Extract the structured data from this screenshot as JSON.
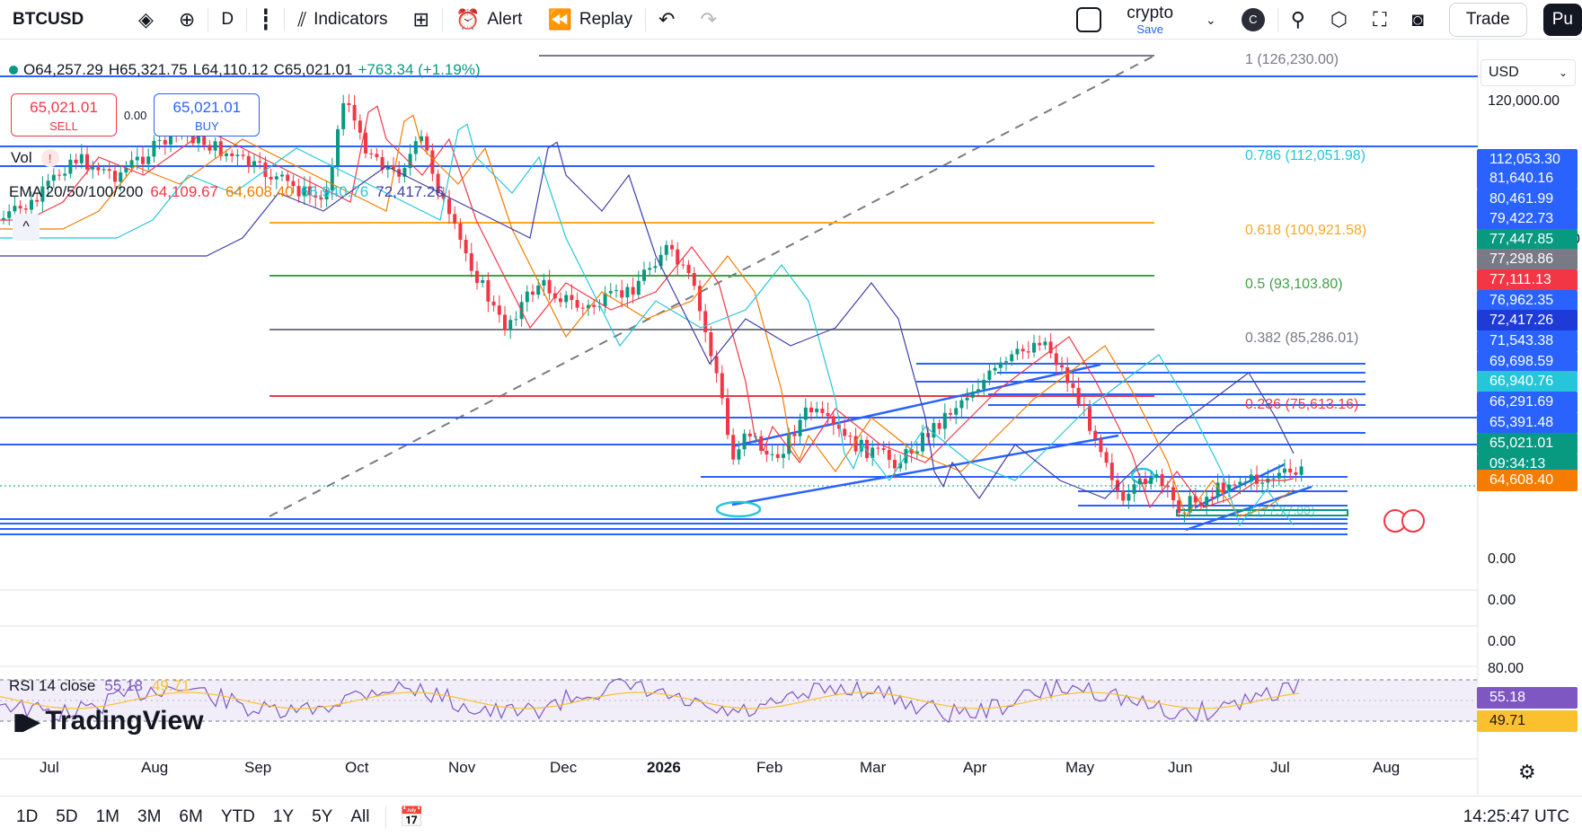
{
  "toolbar": {
    "symbol": "BTCUSD",
    "interval": "D",
    "indicators_label": "Indicators",
    "alert_label": "Alert",
    "replay_label": "Replay",
    "layout_name": "crypto",
    "layout_save": "Save",
    "avatar_letter": "C",
    "trade_label": "Trade",
    "publish_label": "Pu"
  },
  "legend": {
    "open": "O64,257.29",
    "high": "H65,321.75",
    "low": "L64,110.12",
    "close": "C65,021.01",
    "change": "+763.34 (+1.19%)",
    "sell_price": "65,021.01",
    "sell_label": "SELL",
    "buy_price": "65,021.01",
    "buy_label": "BUY",
    "spread": "0.00",
    "vol_label": "Vol",
    "ema_label": "EMA 20/50/100/200",
    "ema20": "64,109.67",
    "ema50": "64,608.40",
    "ema100": "66,940.76",
    "ema200": "72,417.26",
    "rsi_label": "RSI 14 close",
    "rsi_value": "55.18",
    "rsi_ma": "49.71",
    "logo_text": "TradingView",
    "collapse_glyph": "^"
  },
  "fib_labels": {
    "f1": "1 (126,230.00)",
    "f786": "0.786 (112,051.98)",
    "f618": "0.618 (100,921.58)",
    "f5": "0.5 (93,103.80)",
    "f382": "0.382 (85,286.01)",
    "f236": "0.236 (75,613.16)",
    "f0": "0 (77,77.80)"
  },
  "price_scale": {
    "currency": "USD",
    "tick_120k": "120,000.00",
    "edge_digit": "0",
    "labels": [
      {
        "text": "112,053.30",
        "color": "#2962ff"
      },
      {
        "text": "81,640.16",
        "color": "#2962ff"
      },
      {
        "text": "80,461.99",
        "color": "#2962ff"
      },
      {
        "text": "79,422.73",
        "color": "#2962ff"
      },
      {
        "text": "77,447.85",
        "color": "#089981"
      },
      {
        "text": "77,298.86",
        "color": "#787b86"
      },
      {
        "text": "77,111.13",
        "color": "#f23645"
      },
      {
        "text": "76,962.35",
        "color": "#2962ff"
      },
      {
        "text": "72,417.26",
        "color": "#1e3bd8"
      },
      {
        "text": "71,543.38",
        "color": "#2962ff"
      },
      {
        "text": "69,698.59",
        "color": "#2962ff"
      },
      {
        "text": "66,940.76",
        "color": "#26c6da"
      },
      {
        "text": "66,291.69",
        "color": "#2962ff"
      },
      {
        "text": "65,391.48",
        "color": "#2962ff"
      },
      {
        "text": "65,021.01",
        "color": "#089981"
      },
      {
        "text": "09:34:13",
        "color": "#089981"
      },
      {
        "text": "64,608.40",
        "color": "#f57c00"
      }
    ],
    "zero1": "0.00",
    "zero2": "0.00",
    "zero3": "0.00",
    "rsi_80": "80.00",
    "rsi_val": "55.18",
    "rsi_ma": "49.71"
  },
  "time_axis": [
    "Jul",
    "Aug",
    "Sep",
    "Oct",
    "Nov",
    "Dec",
    "2026",
    "Feb",
    "Mar",
    "Apr",
    "May",
    "Jun",
    "Jul",
    "Aug"
  ],
  "bottom": {
    "ranges": [
      "1D",
      "5D",
      "1M",
      "3M",
      "6M",
      "YTD",
      "1Y",
      "5Y",
      "All"
    ],
    "clock": "14:25:47 UTC"
  },
  "colors": {
    "up": "#089981",
    "down": "#f23645",
    "ema20": "#f23645",
    "ema50": "#f57c00",
    "ema100": "#26c6da",
    "ema200": "#3f3fa8",
    "hline": "#2962ff",
    "rsi": "#7e57c2",
    "rsi_ma": "#fbc02d"
  }
}
